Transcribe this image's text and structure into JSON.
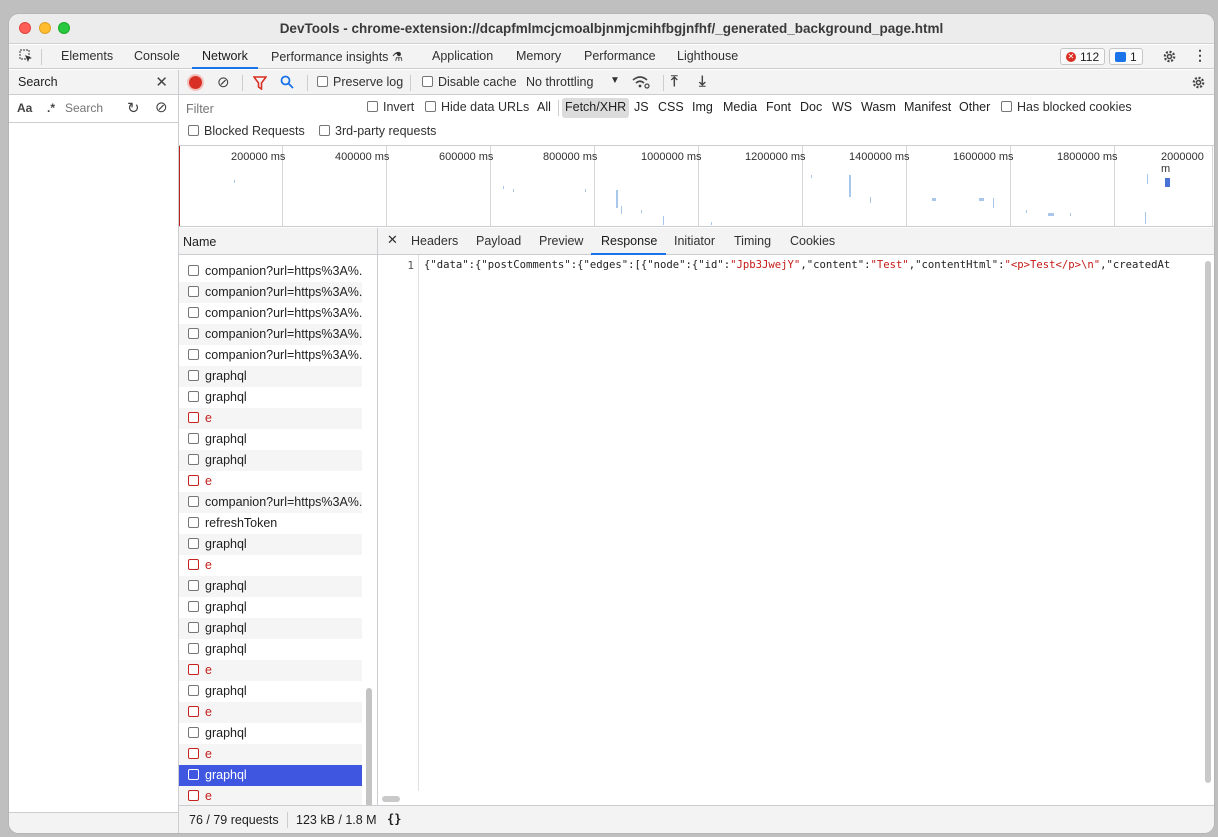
{
  "window": {
    "title": "DevTools - chrome-extension://dcapfmlmcjcmoalbjnmjcmihfbgjnfhf/_generated_background_page.html"
  },
  "tabs": [
    "Elements",
    "Console",
    "Network",
    "Performance insights ⚗",
    "Application",
    "Memory",
    "Performance",
    "Lighthouse"
  ],
  "active_tab": "Network",
  "badges": {
    "errors": "112",
    "messages": "1"
  },
  "search_panel": {
    "title": "Search",
    "case_label": "Aa",
    "regex_label": ".*",
    "placeholder": "Search"
  },
  "toolbar": {
    "preserve_log": "Preserve log",
    "disable_cache": "Disable cache",
    "throttling": "No throttling",
    "filter_placeholder": "Filter",
    "invert": "Invert",
    "hide_data_urls": "Hide data URLs",
    "types": [
      "All",
      "Fetch/XHR",
      "JS",
      "CSS",
      "Img",
      "Media",
      "Font",
      "Doc",
      "WS",
      "Wasm",
      "Manifest",
      "Other"
    ],
    "selected_type": "Fetch/XHR",
    "has_blocked_cookies": "Has blocked cookies",
    "blocked_requests": "Blocked Requests",
    "third_party": "3rd-party requests"
  },
  "overview": {
    "ticks": [
      "200000 ms",
      "400000 ms",
      "600000 ms",
      "800000 ms",
      "1000000 ms",
      "1200000 ms",
      "1400000 ms",
      "1600000 ms",
      "1800000 ms",
      "2000000 m"
    ]
  },
  "requests": {
    "column": "Name",
    "rows": [
      {
        "name": "companion?url=https%3A%...",
        "status": "ok"
      },
      {
        "name": "companion?url=https%3A%...",
        "status": "ok"
      },
      {
        "name": "companion?url=https%3A%...",
        "status": "ok"
      },
      {
        "name": "companion?url=https%3A%...",
        "status": "ok"
      },
      {
        "name": "companion?url=https%3A%...",
        "status": "ok"
      },
      {
        "name": "graphql",
        "status": "ok"
      },
      {
        "name": "graphql",
        "status": "ok"
      },
      {
        "name": "e",
        "status": "error"
      },
      {
        "name": "graphql",
        "status": "ok"
      },
      {
        "name": "graphql",
        "status": "ok"
      },
      {
        "name": "e",
        "status": "error"
      },
      {
        "name": "companion?url=https%3A%...",
        "status": "ok"
      },
      {
        "name": "refreshToken",
        "status": "ok"
      },
      {
        "name": "graphql",
        "status": "ok"
      },
      {
        "name": "e",
        "status": "error"
      },
      {
        "name": "graphql",
        "status": "ok"
      },
      {
        "name": "graphql",
        "status": "ok"
      },
      {
        "name": "graphql",
        "status": "ok"
      },
      {
        "name": "graphql",
        "status": "ok"
      },
      {
        "name": "e",
        "status": "error"
      },
      {
        "name": "graphql",
        "status": "ok"
      },
      {
        "name": "e",
        "status": "error"
      },
      {
        "name": "graphql",
        "status": "ok"
      },
      {
        "name": "e",
        "status": "error"
      },
      {
        "name": "graphql",
        "status": "selected"
      },
      {
        "name": "e",
        "status": "error"
      }
    ],
    "summary": "76 / 79 requests",
    "transfer": "123 kB / 1.8 M"
  },
  "detail": {
    "tabs": [
      "Headers",
      "Payload",
      "Preview",
      "Response",
      "Initiator",
      "Timing",
      "Cookies"
    ],
    "active_tab": "Response",
    "line_number": "1",
    "code_parts": [
      {
        "t": "{\"data\":{\"postComments\":{\"edges\":[{\"node\":{\"id\":",
        "s": false
      },
      {
        "t": "\"Jpb3JwejY\"",
        "s": true
      },
      {
        "t": ",\"content\":",
        "s": false
      },
      {
        "t": "\"Test\"",
        "s": true
      },
      {
        "t": ",\"contentHtml\":",
        "s": false
      },
      {
        "t": "\"<p>Test</p>\\n\"",
        "s": true
      },
      {
        "t": ",\"createdAt",
        "s": false
      }
    ],
    "pretty_print": "{}"
  }
}
